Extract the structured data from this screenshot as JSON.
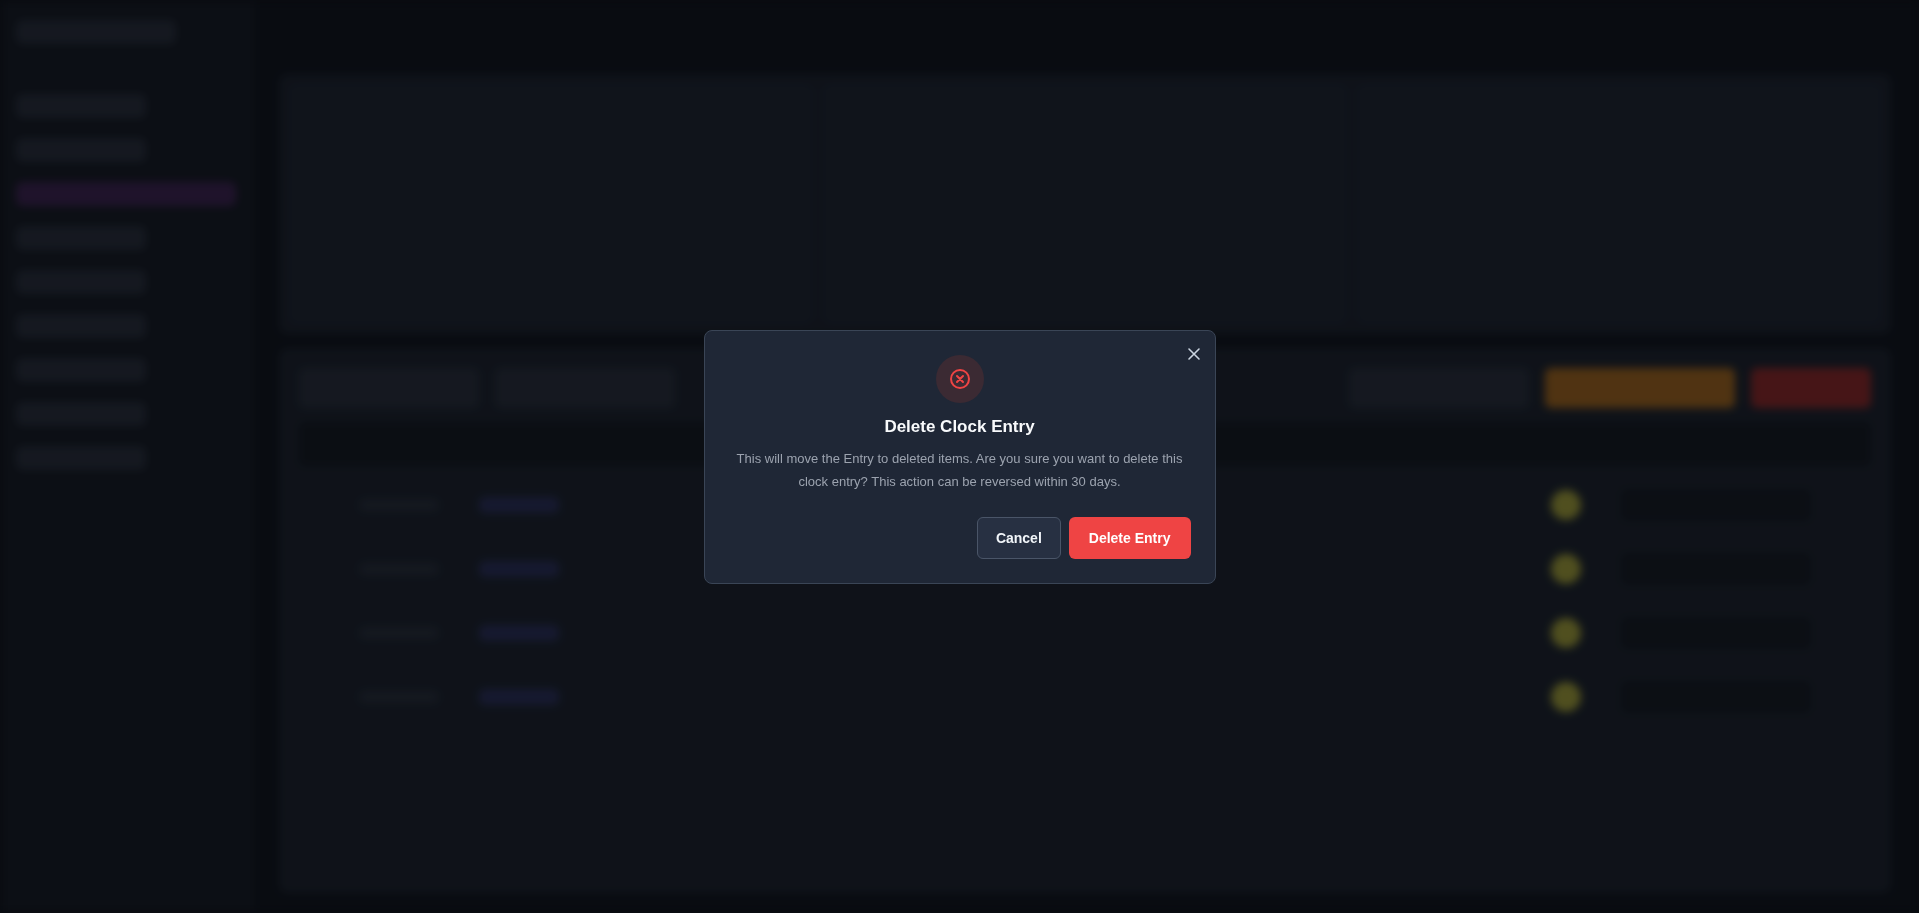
{
  "dialog": {
    "title": "Delete Clock Entry",
    "message": "This will move the Entry to deleted items. Are you sure you want to delete this clock entry? This action can be reversed within 30 days.",
    "buttons": [
      {
        "label": "Cancel",
        "kind": "secondary"
      },
      {
        "label": "Delete Entry",
        "kind": "danger"
      }
    ]
  }
}
